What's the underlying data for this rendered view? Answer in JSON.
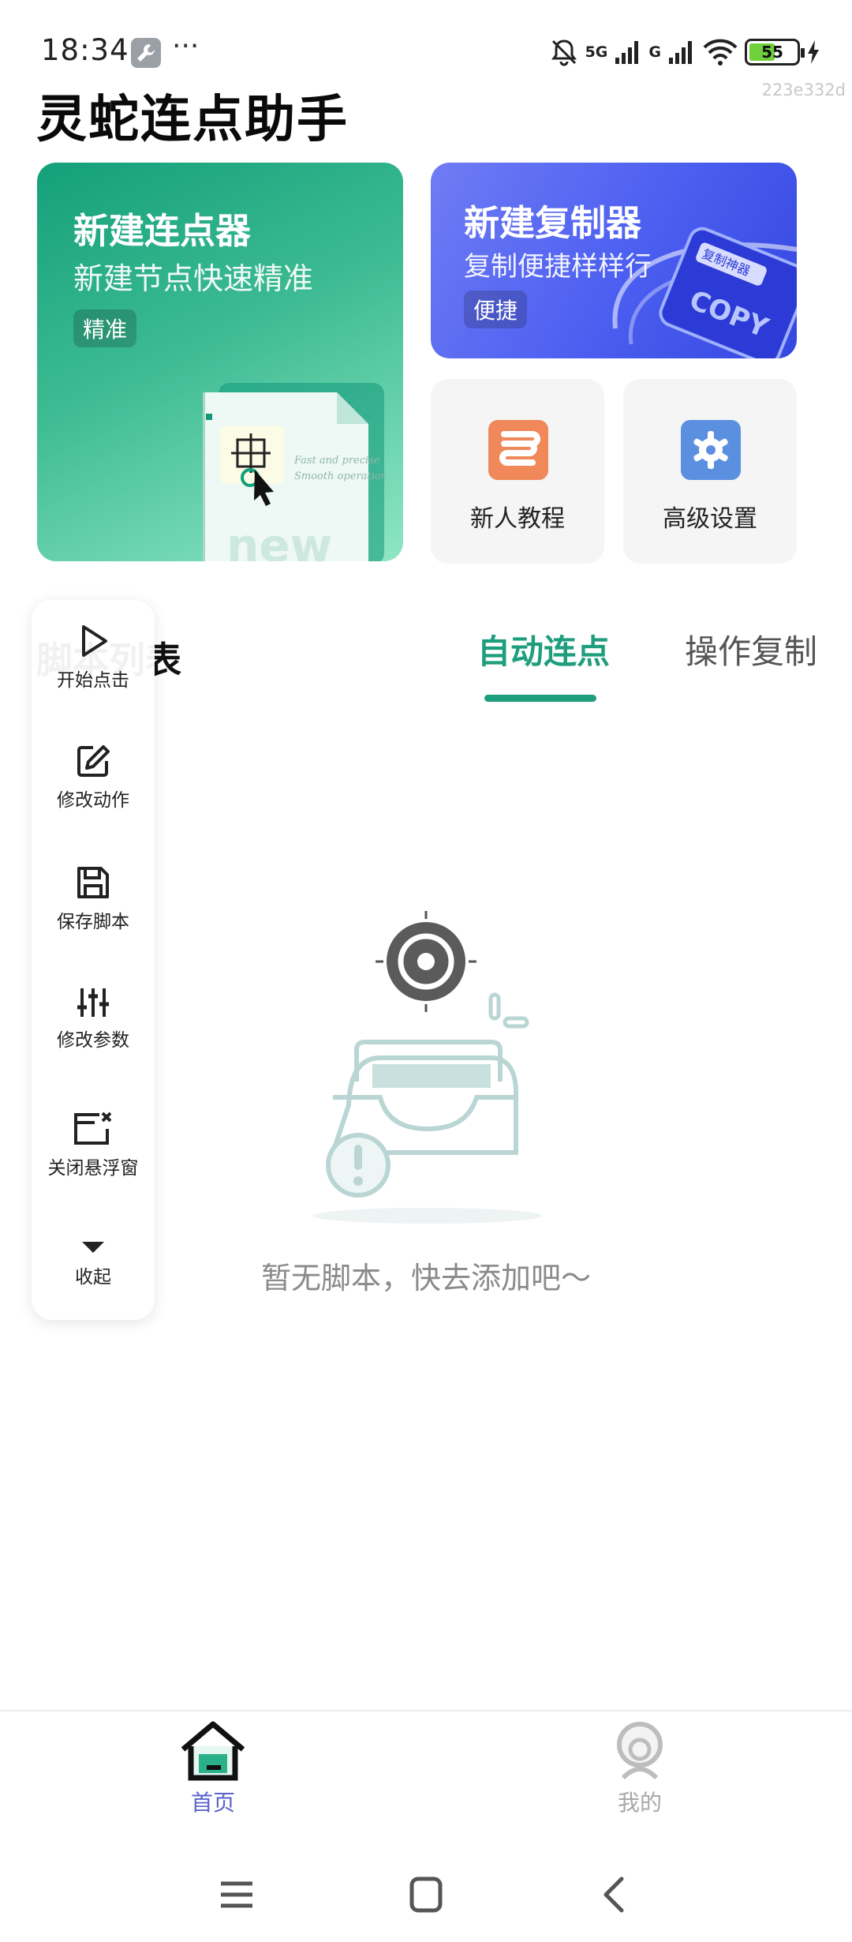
{
  "status_bar": {
    "time": "18:34",
    "dots": "···",
    "network_1": "5G",
    "network_2": "G",
    "battery": "55",
    "device_id": "223e332d"
  },
  "app": {
    "title": "灵蛇连点助手"
  },
  "cards": {
    "clicker": {
      "title": "新建连点器",
      "subtitle": "新建节点快速精准",
      "tag": "精准",
      "illustration_text": "new"
    },
    "copier": {
      "title": "新建复制器",
      "subtitle": "复制便捷样样行",
      "tag": "便捷",
      "illustration_text": "COPY"
    },
    "tutorial": {
      "label": "新人教程",
      "color": "#f0885a",
      "icon": "tutorial-icon"
    },
    "settings": {
      "label": "高级设置",
      "color": "#5b8fe0",
      "icon": "gear-icon"
    }
  },
  "scripts": {
    "section_title": "脚本列表",
    "tabs": [
      {
        "label": "自动连点",
        "active": true
      },
      {
        "label": "操作复制",
        "active": false
      }
    ],
    "empty_text": "暂无脚本，快去添加吧～"
  },
  "floating_panel": {
    "items": [
      {
        "label": "开始点击",
        "icon": "play-icon"
      },
      {
        "label": "修改动作",
        "icon": "edit-icon"
      },
      {
        "label": "保存脚本",
        "icon": "save-icon"
      },
      {
        "label": "修改参数",
        "icon": "sliders-icon"
      },
      {
        "label": "关闭悬浮窗",
        "icon": "close-window-icon"
      },
      {
        "label": "收起",
        "icon": "collapse-icon"
      }
    ]
  },
  "bottom_nav": {
    "items": [
      {
        "label": "首页",
        "icon": "home-icon",
        "active": true
      },
      {
        "label": "我的",
        "icon": "profile-icon",
        "active": false
      }
    ]
  },
  "colors": {
    "accent_green": "#1f9e7e",
    "nav_active": "#5a63c9",
    "copier_blue": "#4b5ef0"
  }
}
